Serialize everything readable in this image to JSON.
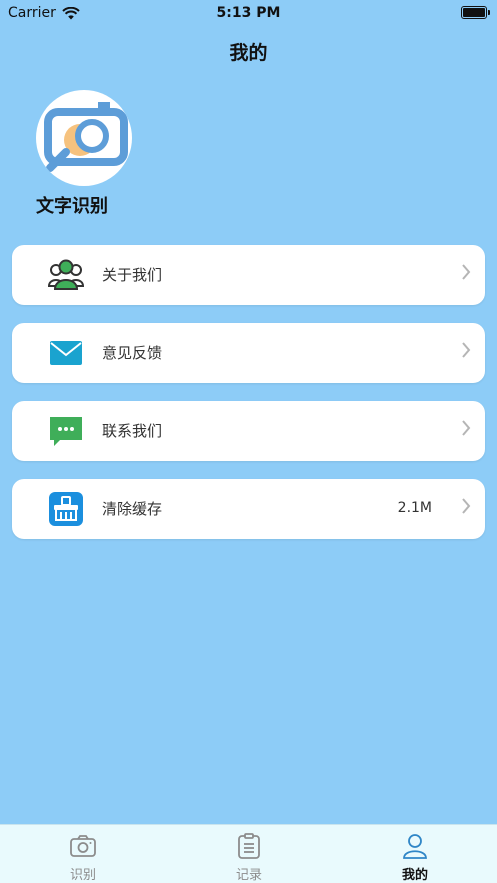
{
  "status": {
    "carrier": "Carrier",
    "time": "5:13 PM"
  },
  "nav": {
    "title": "我的"
  },
  "profile": {
    "app_name": "文字识别"
  },
  "menu": [
    {
      "label": "关于我们",
      "icon": "users-icon"
    },
    {
      "label": "意见反馈",
      "icon": "mail-icon"
    },
    {
      "label": "联系我们",
      "icon": "chat-bubble-icon"
    },
    {
      "label": "清除缓存",
      "icon": "broom-icon",
      "value": "2.1M"
    }
  ],
  "tabs": [
    {
      "label": "识别",
      "icon": "camera-icon",
      "active": false
    },
    {
      "label": "记录",
      "icon": "clipboard-icon",
      "active": false
    },
    {
      "label": "我的",
      "icon": "person-icon",
      "active": true
    }
  ],
  "colors": {
    "background": "#8dccf7",
    "tab_bar": "#e9fafd",
    "active_tab": "#2f86c7",
    "logo_blue": "#5d9dd8",
    "mail_blue": "#1aa3cf",
    "chat_green": "#3fae59",
    "broom_blue": "#1b8fde"
  }
}
